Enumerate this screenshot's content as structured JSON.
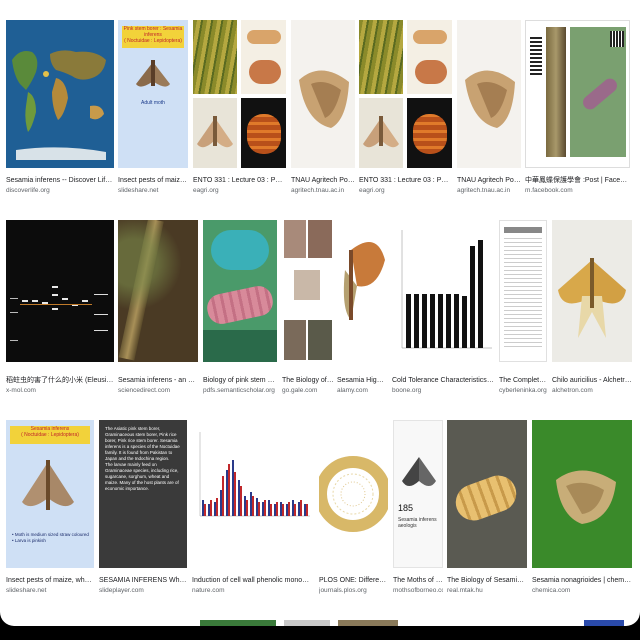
{
  "results": [
    {
      "caption": "Sesamia inferens -- Discover Life mobile",
      "source": "discoverlife.org"
    },
    {
      "caption": "Insect pests of maize, wheat & ra...",
      "source": "slideshare.net"
    },
    {
      "caption": "ENTO 331 : Lecture 03 : Pests of Sorghum",
      "source": "eagri.org"
    },
    {
      "caption": "TNAU Agritech Portal :: Crop ...",
      "source": "agritech.tnau.ac.in"
    },
    {
      "caption": "ENTO 331 : Lecture 03 : Pests of Sorghum",
      "source": "eagri.org"
    },
    {
      "caption": "TNAU Agritech Portal :: Crop ...",
      "source": "agritech.tnau.ac.in"
    },
    {
      "caption": "中華鳳蝶保護學會 :Post | Facebook",
      "source": "m.facebook.com"
    },
    {
      "caption": "稻蛀虫的害了什么的小米 (Eleusine coracana Gaertn...",
      "source": "x-mol.com"
    },
    {
      "caption": "Sesamia inferens - an overview | Science...",
      "source": "sciencedirect.com"
    },
    {
      "caption": "Biology of pink stem borer, Sesamia...",
      "source": "pdfs.semanticscholar.org"
    },
    {
      "caption": "The Biology of Sesami...",
      "source": "go.gale.com"
    },
    {
      "caption": "Sesamia High Resoluti...",
      "source": "alamy.com"
    },
    {
      "caption": "Cold Tolerance Characteristics and Overwintering ...",
      "source": "boone.org"
    },
    {
      "caption": "The Complete Mitocho...",
      "source": "cyberleninka.org"
    },
    {
      "caption": "Chilo auricilius - Alchetron, The Free S...",
      "source": "alchetron.com"
    },
    {
      "caption": "Insect pests of maize, wheat & ragi 1",
      "source": "slideshare.net"
    },
    {
      "caption": "SESAMIA INFERENS Wheat Stem Borer - pp...",
      "source": "slideplayer.com"
    },
    {
      "caption": "Induction of cell wall phenolic monomers as part of direct def...",
      "source": "nature.com"
    },
    {
      "caption": "PLOS ONE: Differential Expressio...",
      "source": "journals.plos.org"
    },
    {
      "caption": "The Moths of Borneo:",
      "source": "mothsofborneo.com"
    },
    {
      "caption": "The Biology of Sesamia inferens (Walke...",
      "source": "real.mtak.hu"
    },
    {
      "caption": "Sesamia nonagrioides | chemica.com",
      "source": "chemica.com"
    }
  ],
  "thumb_text": {
    "slide1_title": "Pink stem borer : Sesamia inferens\n( Noctuidae : Lepidoptera)",
    "slide1_sub": "Adult moth",
    "slide15_title": "Sesamia inferens\n( Noctuidae : Lepidoptera)",
    "slide15_bullets": "• Moth is medium sized straw coloured\n• Larva is pinkish",
    "slide16_text": "The Asiatic pink stem borer, Graminaceous stem borer, Pink rice borer, Pink rice stem borer. Sesamia inferens is a species of the Noctuidae family. It is found from Pakistan to Japan and the Indochina region.\nThe larvae mainly feed on Graminaceae species, including rice, sugarcane, sorghum, wheat and maize. Many of the host plants are of economic importance.",
    "moths_num": "185",
    "moths_label": "Sesamia inferens\naeologis"
  }
}
